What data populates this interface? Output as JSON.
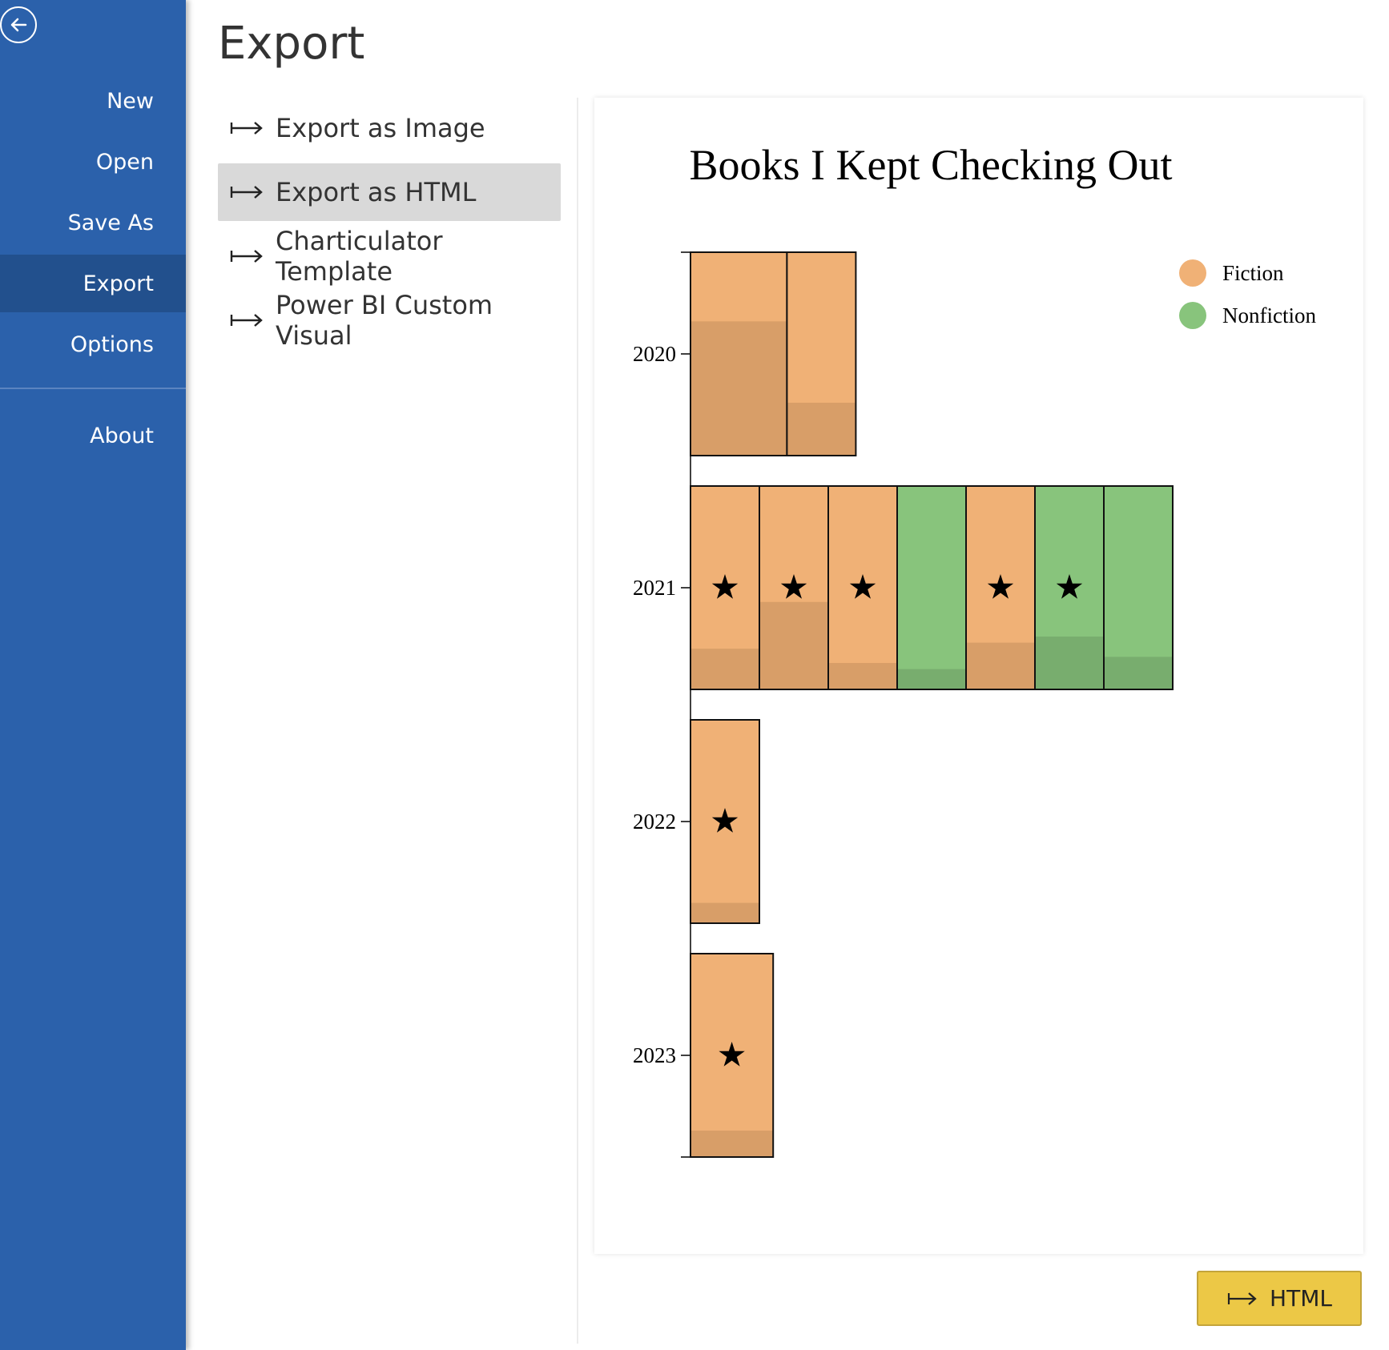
{
  "sidebar": {
    "back_icon": "back-arrow-icon",
    "items": [
      {
        "label": "New"
      },
      {
        "label": "Open"
      },
      {
        "label": "Save As"
      },
      {
        "label": "Export",
        "active": true
      },
      {
        "label": "Options"
      },
      {
        "label": "About"
      }
    ]
  },
  "page_title": "Export",
  "export_menu": {
    "icon": "export-arrow-icon",
    "items": [
      {
        "label": "Export as Image"
      },
      {
        "label": "Export as HTML",
        "selected": true
      },
      {
        "label": "Charticulator Template"
      },
      {
        "label": "Power BI Custom Visual"
      }
    ]
  },
  "export_button": {
    "label": "HTML",
    "icon": "export-arrow-icon"
  },
  "colors": {
    "sidebar": "#2b61ab",
    "sidebar_active": "#22508d",
    "selected_item": "#d9d9d9",
    "button": "#ecc846",
    "fiction": "#f0b176",
    "fiction_dark": "#d89e68",
    "nonfiction": "#88c47c",
    "nonfiction_dark": "#78ad6e"
  },
  "chart_data": {
    "type": "bar",
    "title": "Books I Kept Checking Out",
    "categories": [
      "2020",
      "2021",
      "2022",
      "2023"
    ],
    "legend": {
      "placement": "top-right",
      "entries": [
        {
          "name": "Fiction",
          "color": "#f0b176"
        },
        {
          "name": "Nonfiction",
          "color": "#88c47c"
        }
      ]
    },
    "groups": [
      {
        "year": "2020",
        "books": [
          {
            "genre": "Fiction",
            "width": 1.4,
            "fill": 0.66,
            "starred": false
          },
          {
            "genre": "Fiction",
            "width": 1.0,
            "fill": 0.26,
            "starred": false
          }
        ]
      },
      {
        "year": "2021",
        "books": [
          {
            "genre": "Fiction",
            "width": 1.0,
            "fill": 0.2,
            "starred": true
          },
          {
            "genre": "Fiction",
            "width": 1.0,
            "fill": 0.43,
            "starred": true
          },
          {
            "genre": "Fiction",
            "width": 1.0,
            "fill": 0.13,
            "starred": true
          },
          {
            "genre": "Nonfiction",
            "width": 1.0,
            "fill": 0.1,
            "starred": false
          },
          {
            "genre": "Fiction",
            "width": 1.0,
            "fill": 0.23,
            "starred": true
          },
          {
            "genre": "Nonfiction",
            "width": 1.0,
            "fill": 0.26,
            "starred": true
          },
          {
            "genre": "Nonfiction",
            "width": 1.0,
            "fill": 0.16,
            "starred": false
          }
        ]
      },
      {
        "year": "2022",
        "books": [
          {
            "genre": "Fiction",
            "width": 1.0,
            "fill": 0.1,
            "starred": true
          }
        ]
      },
      {
        "year": "2023",
        "books": [
          {
            "genre": "Fiction",
            "width": 1.2,
            "fill": 0.13,
            "starred": true
          }
        ]
      }
    ]
  }
}
